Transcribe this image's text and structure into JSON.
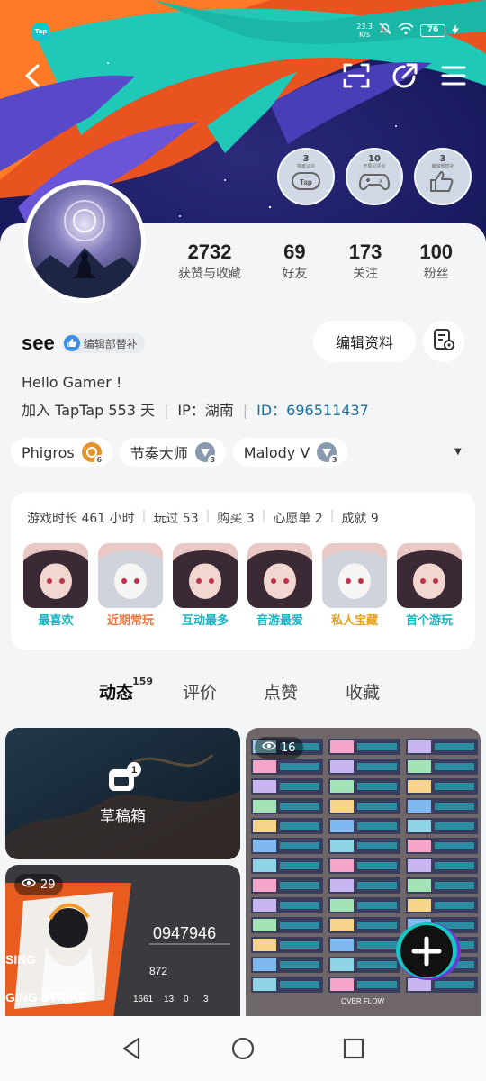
{
  "status_bar": {
    "app_icon_text": "Tap",
    "net_speed_value": "23.3",
    "net_speed_unit": "K/s",
    "battery": "76"
  },
  "top_nav": {
    "icons": [
      "back-icon",
      "scan-icon",
      "share-icon",
      "menu-icon"
    ]
  },
  "achievement_badges": [
    {
      "num": "3",
      "sub": "独家认识",
      "icon": "tap-controller-icon"
    },
    {
      "num": "10",
      "sub": "开局见评论",
      "icon": "gamepad-icon"
    },
    {
      "num": "3",
      "sub": "编辑部替补",
      "icon": "thumbs-up-icon"
    }
  ],
  "stats": [
    {
      "value": "2732",
      "label": "获赞与收藏"
    },
    {
      "value": "69",
      "label": "好友"
    },
    {
      "value": "173",
      "label": "关注"
    },
    {
      "value": "100",
      "label": "粉丝"
    }
  ],
  "profile": {
    "username": "see",
    "role_tag": "编辑部替补",
    "edit_button": "编辑资料",
    "bio": "Hello Gamer !",
    "joined": "加入 TapTap 553 天",
    "ip": "IP：湖南",
    "id": "ID：696511437"
  },
  "game_chips": [
    {
      "name": "Phigros",
      "level": "6",
      "color": "#e7932d"
    },
    {
      "name": "节奏大师",
      "level": "3",
      "color": "#8899b0"
    },
    {
      "name": "Malody V",
      "level": "3",
      "color": "#8899b0"
    }
  ],
  "summary": {
    "items": [
      "游戏时长 461 小时",
      "玩过 53",
      "购买 3",
      "心愿单 2",
      "成就 9"
    ],
    "tiles": [
      {
        "label": "最喜欢",
        "color": "#14b6c4"
      },
      {
        "label": "近期常玩",
        "color": "#e9733a"
      },
      {
        "label": "互动最多",
        "color": "#14b6c4"
      },
      {
        "label": "音游最爱",
        "color": "#14b6c4"
      },
      {
        "label": "私人宝藏",
        "color": "#e6a11e"
      },
      {
        "label": "首个游玩",
        "color": "#14b6c4"
      }
    ]
  },
  "tabs": [
    {
      "label": "动态",
      "count": "159"
    },
    {
      "label": "评价"
    },
    {
      "label": "点赞"
    },
    {
      "label": "收藏"
    }
  ],
  "feed": {
    "drafts_label": "草稿箱",
    "drafts_badge": "1",
    "right_views": "16",
    "left2_views": "29",
    "score_text": "0947946",
    "combo_text": "872",
    "bottom_text_1": "1661",
    "bottom_text_2": "13",
    "bottom_text_3": "0",
    "bottom_text_4": "3",
    "overflow_text": "OVER FLOW"
  },
  "navbar": {
    "icons": [
      "back-triangle-icon",
      "home-circle-icon",
      "recents-square-icon"
    ]
  }
}
